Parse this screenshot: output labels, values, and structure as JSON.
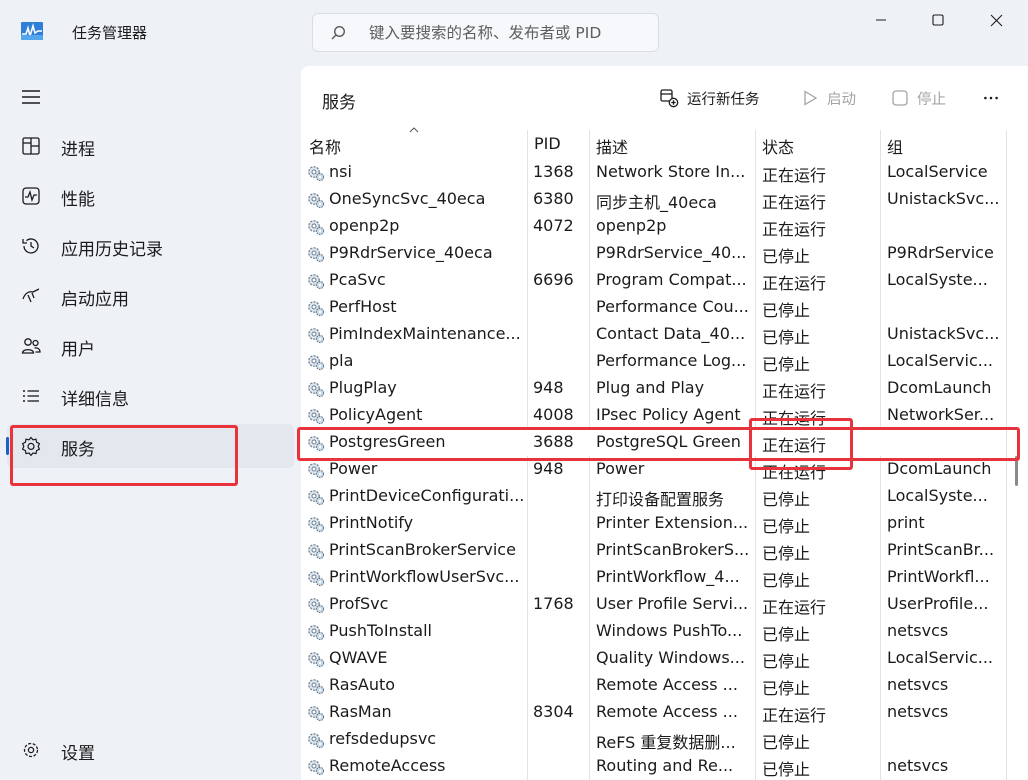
{
  "app": {
    "title": "任务管理器"
  },
  "search": {
    "placeholder": "键入要搜索的名称、发布者或 PID"
  },
  "sidebar": {
    "items": [
      {
        "label": "进程",
        "icon": "processes-icon"
      },
      {
        "label": "性能",
        "icon": "performance-icon"
      },
      {
        "label": "应用历史记录",
        "icon": "app-history-icon"
      },
      {
        "label": "启动应用",
        "icon": "startup-apps-icon"
      },
      {
        "label": "用户",
        "icon": "users-icon"
      },
      {
        "label": "详细信息",
        "icon": "details-icon"
      },
      {
        "label": "服务",
        "icon": "services-icon",
        "active": true
      }
    ],
    "settings_label": "设置"
  },
  "page": {
    "title": "服务"
  },
  "toolbar": {
    "run_new_task": "运行新任务",
    "start": "启动",
    "stop": "停止"
  },
  "table": {
    "columns": [
      "名称",
      "PID",
      "描述",
      "状态",
      "组"
    ],
    "sort_column": "名称",
    "rows": [
      {
        "name": "nsi",
        "pid": "1368",
        "desc": "Network Store In...",
        "status": "正在运行",
        "group": "LocalService"
      },
      {
        "name": "OneSyncSvc_40eca",
        "pid": "6380",
        "desc": "同步主机_40eca",
        "status": "正在运行",
        "group": "UnistackSvc..."
      },
      {
        "name": "openp2p",
        "pid": "4072",
        "desc": "openp2p",
        "status": "正在运行",
        "group": ""
      },
      {
        "name": "P9RdrService_40eca",
        "pid": "",
        "desc": "P9RdrService_40...",
        "status": "已停止",
        "group": "P9RdrService"
      },
      {
        "name": "PcaSvc",
        "pid": "6696",
        "desc": "Program Compat...",
        "status": "正在运行",
        "group": "LocalSyste..."
      },
      {
        "name": "PerfHost",
        "pid": "",
        "desc": "Performance Cou...",
        "status": "已停止",
        "group": ""
      },
      {
        "name": "PimIndexMaintenance...",
        "pid": "",
        "desc": "Contact Data_40...",
        "status": "已停止",
        "group": "UnistackSvc..."
      },
      {
        "name": "pla",
        "pid": "",
        "desc": "Performance Log...",
        "status": "已停止",
        "group": "LocalServic..."
      },
      {
        "name": "PlugPlay",
        "pid": "948",
        "desc": "Plug and Play",
        "status": "正在运行",
        "group": "DcomLaunch"
      },
      {
        "name": "PolicyAgent",
        "pid": "4008",
        "desc": "IPsec Policy Agent",
        "status": "正在运行",
        "group": "NetworkSer..."
      },
      {
        "name": "PostgresGreen",
        "pid": "3688",
        "desc": "PostgreSQL Green",
        "status": "正在运行",
        "group": "",
        "highlighted": true
      },
      {
        "name": "Power",
        "pid": "948",
        "desc": "Power",
        "status": "正在运行",
        "group": "DcomLaunch"
      },
      {
        "name": "PrintDeviceConfigurati...",
        "pid": "",
        "desc": "打印设备配置服务",
        "status": "已停止",
        "group": "LocalSyste..."
      },
      {
        "name": "PrintNotify",
        "pid": "",
        "desc": "Printer Extension...",
        "status": "已停止",
        "group": "print"
      },
      {
        "name": "PrintScanBrokerService",
        "pid": "",
        "desc": "PrintScanBrokerS...",
        "status": "已停止",
        "group": "PrintScanBr..."
      },
      {
        "name": "PrintWorkflowUserSvc...",
        "pid": "",
        "desc": "PrintWorkflow_4...",
        "status": "已停止",
        "group": "PrintWorkfl..."
      },
      {
        "name": "ProfSvc",
        "pid": "1768",
        "desc": "User Profile Servi...",
        "status": "正在运行",
        "group": "UserProfile..."
      },
      {
        "name": "PushToInstall",
        "pid": "",
        "desc": "Windows PushTo...",
        "status": "已停止",
        "group": "netsvcs"
      },
      {
        "name": "QWAVE",
        "pid": "",
        "desc": "Quality Windows...",
        "status": "已停止",
        "group": "LocalServic..."
      },
      {
        "name": "RasAuto",
        "pid": "",
        "desc": "Remote Access ...",
        "status": "已停止",
        "group": "netsvcs"
      },
      {
        "name": "RasMan",
        "pid": "8304",
        "desc": "Remote Access ...",
        "status": "正在运行",
        "group": "netsvcs"
      },
      {
        "name": "refsdedupsvc",
        "pid": "",
        "desc": "ReFS 重复数据删...",
        "status": "已停止",
        "group": ""
      },
      {
        "name": "RemoteAccess",
        "pid": "",
        "desc": "Routing and Re...",
        "status": "已停止",
        "group": "netsvcs"
      }
    ]
  },
  "colors": {
    "accent": "#1a62c8",
    "highlight": "#e8323c"
  }
}
